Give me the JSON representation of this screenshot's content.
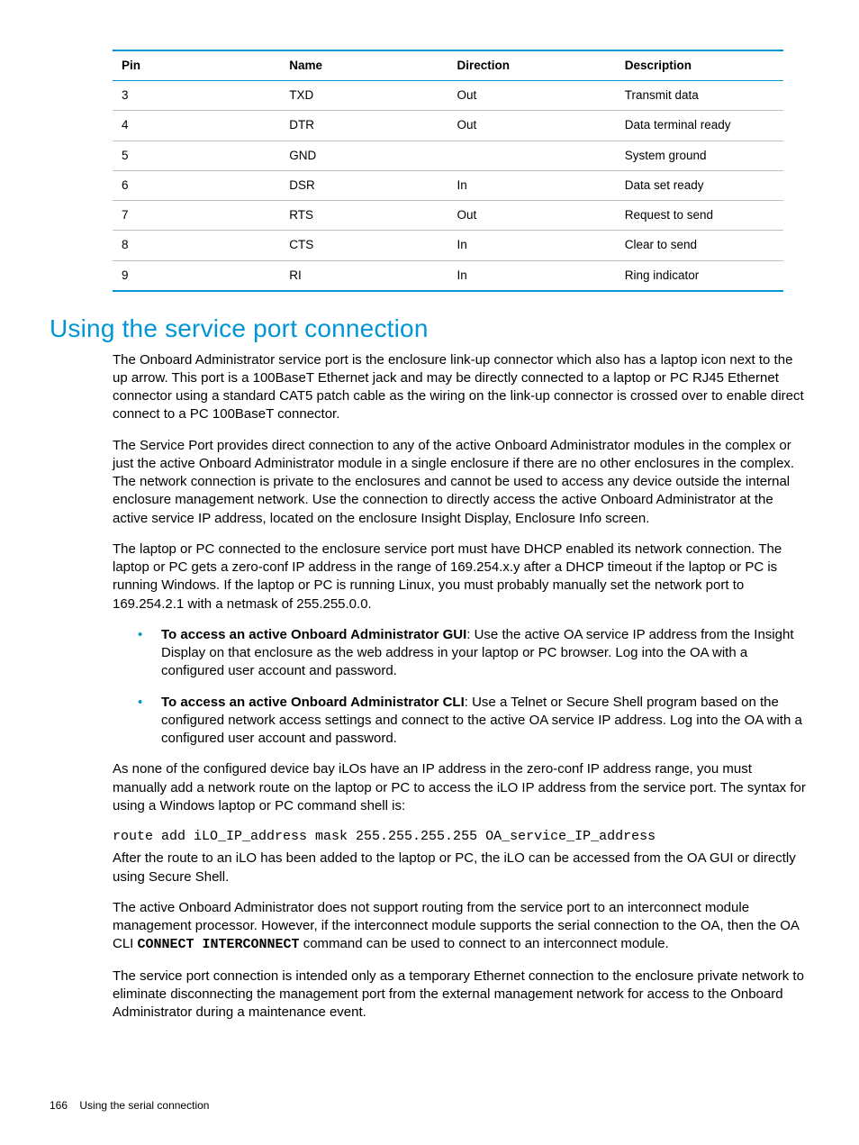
{
  "table": {
    "headers": {
      "pin": "Pin",
      "name": "Name",
      "direction": "Direction",
      "description": "Description"
    },
    "rows": [
      {
        "pin": "3",
        "name": "TXD",
        "direction": "Out",
        "description": "Transmit data"
      },
      {
        "pin": "4",
        "name": "DTR",
        "direction": "Out",
        "description": "Data terminal ready"
      },
      {
        "pin": "5",
        "name": "GND",
        "direction": "",
        "description": "System ground"
      },
      {
        "pin": "6",
        "name": "DSR",
        "direction": "In",
        "description": "Data set ready"
      },
      {
        "pin": "7",
        "name": "RTS",
        "direction": "Out",
        "description": "Request to send"
      },
      {
        "pin": "8",
        "name": "CTS",
        "direction": "In",
        "description": "Clear to send"
      },
      {
        "pin": "9",
        "name": "RI",
        "direction": "In",
        "description": "Ring indicator"
      }
    ]
  },
  "section_heading": "Using the service port connection",
  "paragraphs": {
    "p1": "The Onboard Administrator service port is the enclosure link-up connector which also has a laptop icon next to the up arrow. This port is a 100BaseT Ethernet jack and may be directly connected to a laptop or PC RJ45 Ethernet connector using a standard CAT5 patch cable as the wiring on the link-up connector is crossed over to enable direct connect to a PC 100BaseT connector.",
    "p2": "The Service Port provides direct connection to any of the active Onboard Administrator modules in the complex or just the active Onboard Administrator module in a single enclosure if there are no other enclosures in the complex. The network connection is private to the enclosures and cannot be used to access any device outside the internal enclosure management network. Use the connection to directly access the active Onboard Administrator at the active service IP address, located on the enclosure Insight Display, Enclosure Info screen.",
    "p3": "The laptop or PC connected to the enclosure service port must have DHCP enabled its network connection. The laptop or PC gets a zero-conf IP address in the range of 169.254.x.y after a DHCP timeout if the laptop or PC is running Windows. If the laptop or PC is running Linux, you must probably manually set the network port to 169.254.2.1 with a netmask of 255.255.0.0.",
    "p4": "As none of the configured device bay iLOs have an IP address in the zero-conf IP address range, you must manually add a network route on the laptop or PC to access the iLO IP address from the service port. The syntax for using a Windows laptop or PC command shell is:",
    "p5": "After the route to an iLO has been added to the laptop or PC, the iLO can be accessed from the OA GUI or directly using Secure Shell.",
    "p6a": "The active Onboard Administrator does not support routing from the service port to an interconnect module management processor. However, if the interconnect module supports the serial connection to the OA, then the OA CLI ",
    "p6_cmd": "CONNECT INTERCONNECT",
    "p6b": " command can be used to connect to an interconnect module.",
    "p7": "The service port connection is intended only as a temporary Ethernet connection to the enclosure private network to eliminate disconnecting the management port from the external management network for access to the Onboard Administrator during a maintenance event."
  },
  "bullets": {
    "b1_strong": "To access an active Onboard Administrator GUI",
    "b1_rest": ": Use the active OA service IP address from the Insight Display on that enclosure as the web address in your laptop or PC browser. Log into the OA with a configured user account and password.",
    "b2_strong": "To access an active Onboard Administrator CLI",
    "b2_rest": ": Use a Telnet or Secure Shell program based on the configured network access settings and connect to the active OA service IP address. Log into the OA with a configured user account and password."
  },
  "command": "route add iLO_IP_address mask 255.255.255.255 OA_service_IP_address",
  "footer": {
    "page_number": "166",
    "section": "Using the serial connection"
  }
}
